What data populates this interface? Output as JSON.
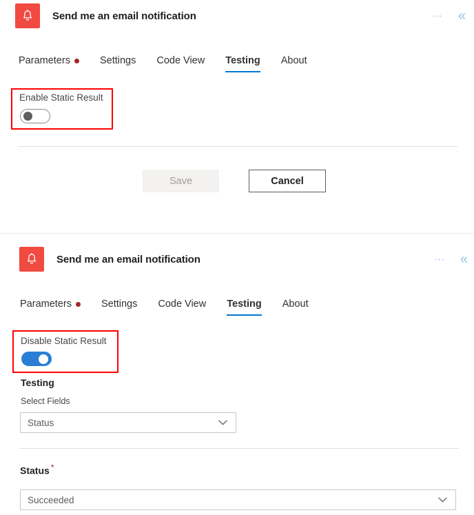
{
  "panels": [
    {
      "header": {
        "icon": "bell-icon",
        "icon_color": "#F04A41",
        "title": "Send me an email notification",
        "ellipsis_label": "⋯",
        "collapse_label": "«"
      },
      "tabs": [
        {
          "label": "Parameters",
          "selected": false,
          "dot": true
        },
        {
          "label": "Settings",
          "selected": false,
          "dot": false
        },
        {
          "label": "Code View",
          "selected": false,
          "dot": false
        },
        {
          "label": "Testing",
          "selected": true,
          "dot": false
        },
        {
          "label": "About",
          "selected": false,
          "dot": false
        }
      ],
      "static_result": {
        "label": "Enable Static Result",
        "state": "off"
      },
      "buttons": {
        "save_label": "Save",
        "cancel_label": "Cancel"
      }
    },
    {
      "header": {
        "icon": "bell-icon",
        "icon_color": "#F04A41",
        "title": "Send me an email notification",
        "ellipsis_label": "⋯",
        "collapse_label": "«"
      },
      "tabs": [
        {
          "label": "Parameters",
          "selected": false,
          "dot": true
        },
        {
          "label": "Settings",
          "selected": false,
          "dot": false
        },
        {
          "label": "Code View",
          "selected": false,
          "dot": false
        },
        {
          "label": "Testing",
          "selected": true,
          "dot": false
        },
        {
          "label": "About",
          "selected": false,
          "dot": false
        }
      ],
      "static_result": {
        "label": "Disable Static Result",
        "state": "on"
      },
      "testing": {
        "heading": "Testing",
        "select_fields_label": "Select Fields",
        "select_fields_value": "Status"
      },
      "status": {
        "label": "Status",
        "required_marker": "*",
        "value": "Succeeded"
      }
    }
  ],
  "annotations": {
    "highlight_color": "#FF0000"
  }
}
